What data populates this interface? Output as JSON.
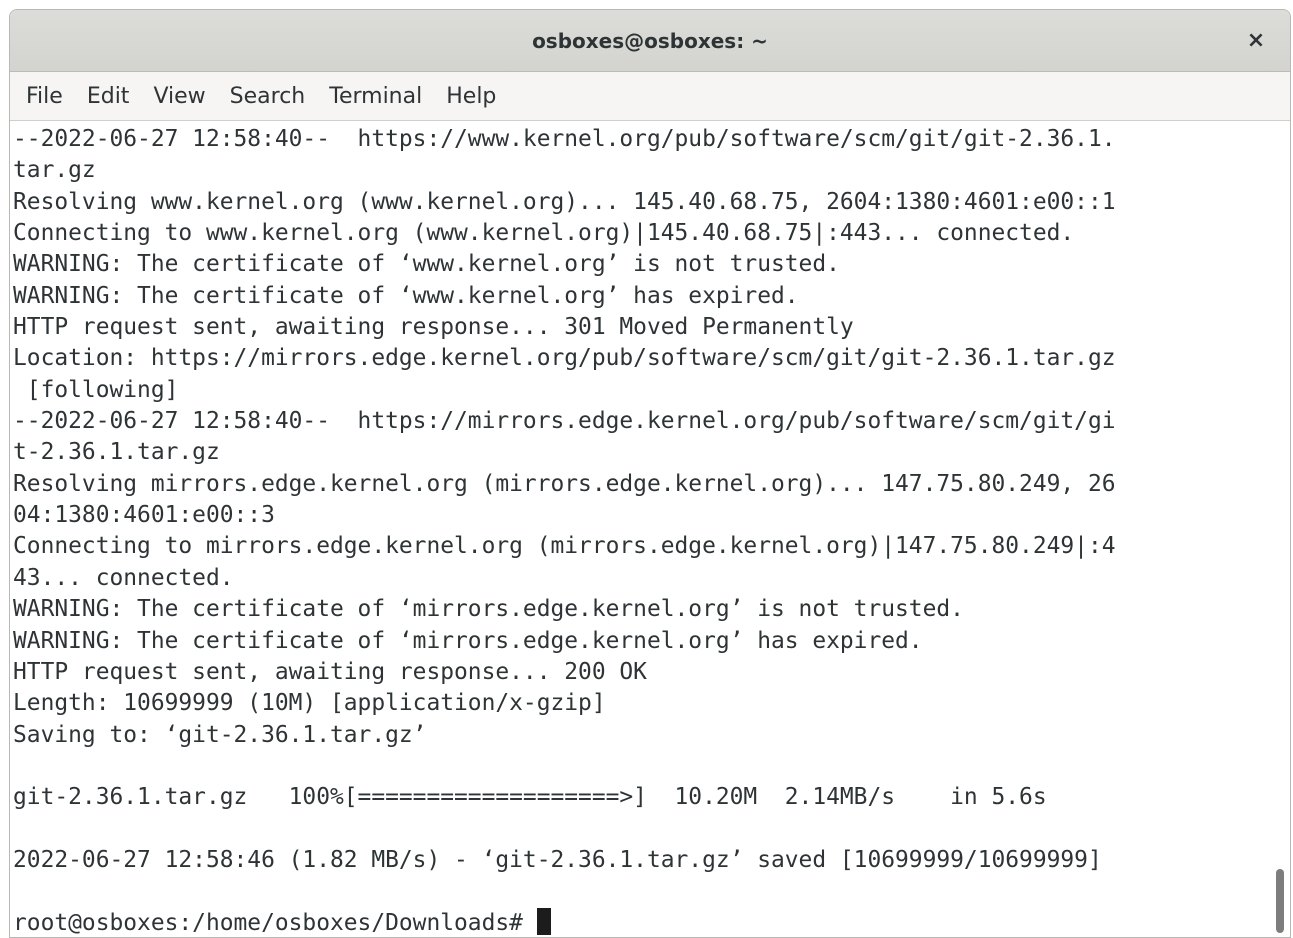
{
  "window": {
    "title": "osboxes@osboxes: ~",
    "close_icon": "×"
  },
  "menubar": {
    "items": [
      "File",
      "Edit",
      "View",
      "Search",
      "Terminal",
      "Help"
    ]
  },
  "terminal": {
    "lines": [
      "--2022-06-27 12:58:40--  https://www.kernel.org/pub/software/scm/git/git-2.36.1.",
      "tar.gz",
      "Resolving www.kernel.org (www.kernel.org)... 145.40.68.75, 2604:1380:4601:e00::1",
      "Connecting to www.kernel.org (www.kernel.org)|145.40.68.75|:443... connected.",
      "WARNING: The certificate of ‘www.kernel.org’ is not trusted.",
      "WARNING: The certificate of ‘www.kernel.org’ has expired.",
      "HTTP request sent, awaiting response... 301 Moved Permanently",
      "Location: https://mirrors.edge.kernel.org/pub/software/scm/git/git-2.36.1.tar.gz",
      " [following]",
      "--2022-06-27 12:58:40--  https://mirrors.edge.kernel.org/pub/software/scm/git/gi",
      "t-2.36.1.tar.gz",
      "Resolving mirrors.edge.kernel.org (mirrors.edge.kernel.org)... 147.75.80.249, 26",
      "04:1380:4601:e00::3",
      "Connecting to mirrors.edge.kernel.org (mirrors.edge.kernel.org)|147.75.80.249|:4",
      "43... connected.",
      "WARNING: The certificate of ‘mirrors.edge.kernel.org’ is not trusted.",
      "WARNING: The certificate of ‘mirrors.edge.kernel.org’ has expired.",
      "HTTP request sent, awaiting response... 200 OK",
      "Length: 10699999 (10M) [application/x-gzip]",
      "Saving to: ‘git-2.36.1.tar.gz’",
      "",
      "git-2.36.1.tar.gz   100%[===================>]  10.20M  2.14MB/s    in 5.6s",
      "",
      "2022-06-27 12:58:46 (1.82 MB/s) - ‘git-2.36.1.tar.gz’ saved [10699999/10699999]",
      ""
    ],
    "prompt": "root@osboxes:/home/osboxes/Downloads# "
  }
}
